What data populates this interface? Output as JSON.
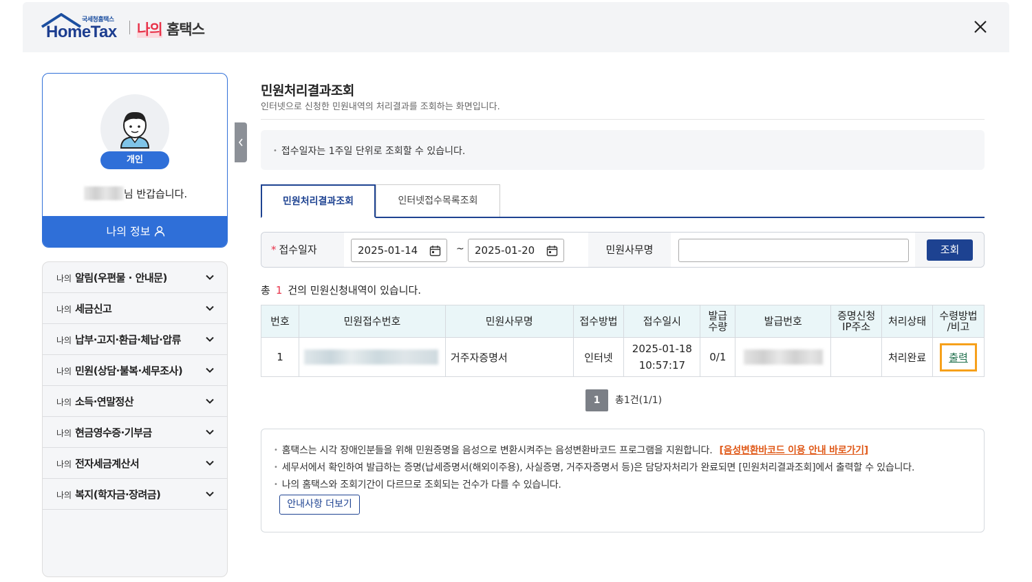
{
  "header": {
    "logo_small": "국세청홈택스",
    "logo_big": "HomeTax",
    "title_accent": "나의",
    "title_rest": "홈택스"
  },
  "profile": {
    "badge": "개인",
    "greeting_suffix": "님 반갑습니다.",
    "myinfo_label": "나의 정보"
  },
  "menu": {
    "items": [
      {
        "prefix": "나의",
        "label": "알림(우편물 · 안내문)"
      },
      {
        "prefix": "나의",
        "label": "세금신고"
      },
      {
        "prefix": "나의",
        "label": "납부·고지·환급·체납·압류"
      },
      {
        "prefix": "나의",
        "label": "민원(상담·불복·세무조사)"
      },
      {
        "prefix": "나의",
        "label": "소득·연말정산"
      },
      {
        "prefix": "나의",
        "label": "현금영수증·기부금"
      },
      {
        "prefix": "나의",
        "label": "전자세금계산서"
      },
      {
        "prefix": "나의",
        "label": "복지(학자금·장려금)"
      }
    ]
  },
  "page": {
    "title": "민원처리결과조회",
    "subtitle": "인터넷으로 신청한 민원내역의 처리결과를 조회하는 화면입니다.",
    "notice": "접수일자는 1주일 단위로 조회할 수 있습니다."
  },
  "tabs": {
    "active": "민원처리결과조회",
    "inactive": "인터넷접수목록조회"
  },
  "search": {
    "date_label": "접수일자",
    "required_mark": "*",
    "date_from": "2025-01-14",
    "separator": "~",
    "date_to": "2025-01-20",
    "name_label": "민원사무명",
    "name_value": "",
    "button": "조회"
  },
  "count": {
    "prefix": "총",
    "value": "1",
    "suffix": "건의 민원신청내역이 있습니다."
  },
  "table": {
    "headers": [
      "번호",
      "민원접수번호",
      "민원사무명",
      "접수방법",
      "접수일시",
      "발급\n수량",
      "발급번호",
      "증명신청\nIP주소",
      "처리상태",
      "수령방법\n/비고"
    ],
    "rows": [
      {
        "no": "1",
        "name": "거주자증명서",
        "method": "인터넷",
        "date": "2025-01-18",
        "time": "10:57:17",
        "qty": "0/1",
        "ip": "",
        "status": "처리완료",
        "action": "출력"
      }
    ]
  },
  "pagination": {
    "current": "1",
    "summary": "총1건(1/1)"
  },
  "guide": {
    "line1": "홈택스는 시각 장애인분들을 위해 민원증명을 음성으로 변환시켜주는 음성변환바코드 프로그램을 지원합니다.",
    "line1_link": "[음성변환바코드 이용 안내 바로가기]",
    "line2": "세무서에서 확인하여 발급하는 증명(납세증명서(해외이주용), 사실증명, 거주자증명서 등)은 담당자처리가 완료되면 [민원처리결과조회]에서 출력할 수 있습니다.",
    "line3": "나의 홈택스와 조회기간이 다르므로 조회되는 건수가 다를 수 있습니다.",
    "more_button": "안내사항 더보기"
  },
  "colors": {
    "primary_navy": "#1d4291",
    "primary_blue": "#2f6fd8",
    "accent_red": "#e8334a",
    "highlight_orange": "#f6a01a"
  },
  "icons": [
    "close-icon",
    "user-avatar-icon",
    "person-icon",
    "chevron-down-icon",
    "calendar-icon",
    "chevron-left-icon"
  ]
}
